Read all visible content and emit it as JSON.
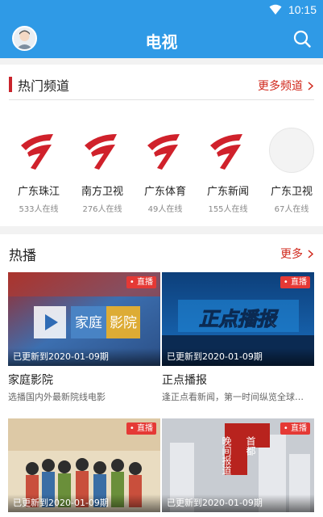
{
  "status_bar": {
    "time": "10:15"
  },
  "app_bar": {
    "title": "电视"
  },
  "hot_channels": {
    "title": "热门频道",
    "more": "更多频道",
    "items": [
      {
        "name": "广东珠江",
        "online": "533人在线"
      },
      {
        "name": "南方卫视",
        "online": "276人在线"
      },
      {
        "name": "广东体育",
        "online": "49人在线"
      },
      {
        "name": "广东新闻",
        "online": "155人在线"
      },
      {
        "name": "广东卫视",
        "online": "67人在线"
      }
    ]
  },
  "hot_play": {
    "title": "热播",
    "more": "更多",
    "cards": [
      {
        "title": "家庭影院",
        "desc": "选播国内外最新院线电影",
        "badge": "• 直播",
        "update": "已更新到2020-01-09期",
        "thumb_text_a": "家庭",
        "thumb_text_b": "影院"
      },
      {
        "title": "正点播报",
        "desc": "逢正点看新闻，第一时间纵览全球…",
        "badge": "• 直播",
        "update": "已更新到2020-01-09期",
        "thumb_text": "正点播报"
      },
      {
        "title": "",
        "desc": "",
        "badge": "• 直播",
        "update": "已更新到2020-01-09期",
        "thumb_text": ""
      },
      {
        "title": "",
        "desc": "",
        "badge": "• 直播",
        "update": "已更新到2020-01-09期",
        "thumb_text_a": "晚间报道",
        "thumb_text_b": "首都"
      }
    ]
  },
  "colors": {
    "primary": "#2f9ae6",
    "accent": "#c9242c",
    "link": "#d0281c",
    "live": "#e53935"
  }
}
